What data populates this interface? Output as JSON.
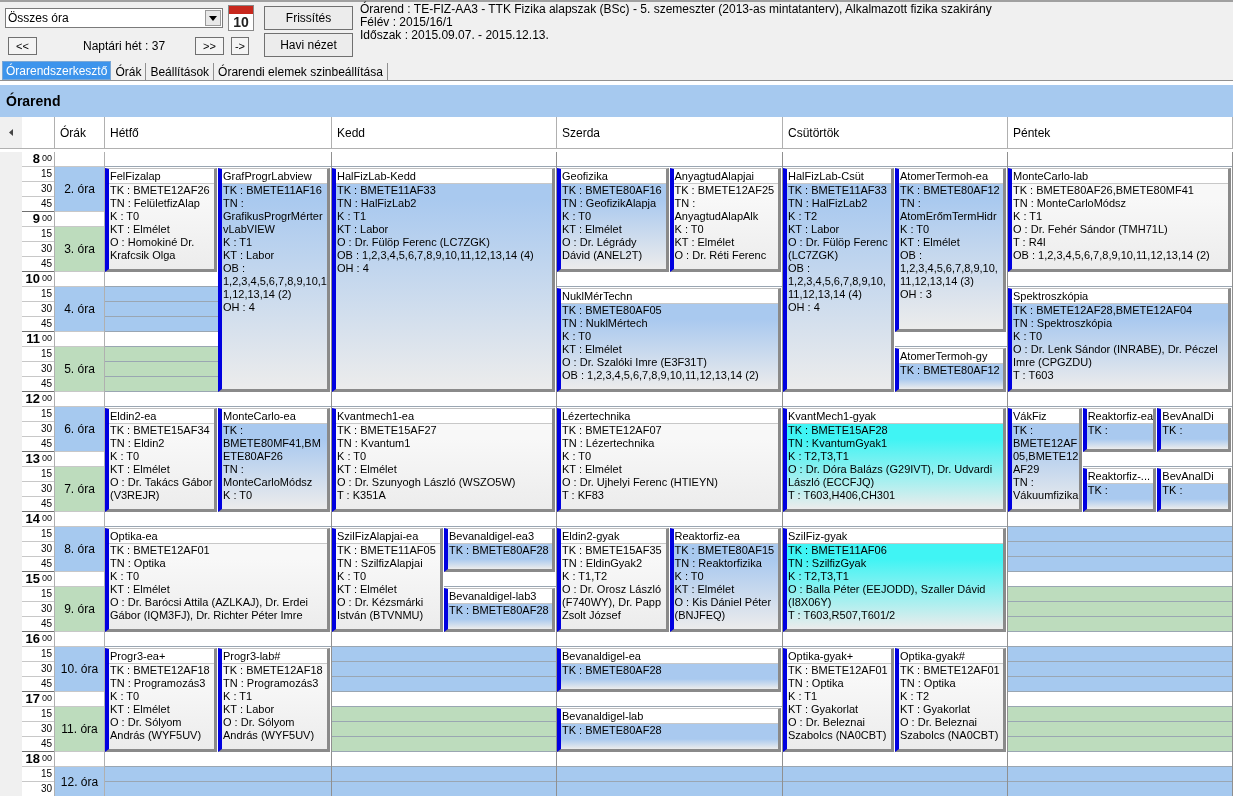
{
  "toolbar": {
    "filter": {
      "value": "Összes óra"
    },
    "calendar_day": "10",
    "prev_button": "<<",
    "week_label": "Naptári hét : 37",
    "next_button": ">>",
    "goto_button": "->",
    "refresh_button": "Frissítés",
    "month_button": "Havi nézet"
  },
  "info": [
    "Órarend : TE-FIZ-AA3 - TTK Fizika alapszak (BSc) - 5. szemeszter (2013-as mintatanterv), Alkalmazott fizika szakirány",
    "Félév : 2015/16/1",
    "Időszak : 2015.09.07. - 2015.12.13."
  ],
  "tabs": [
    {
      "label": "Órarendszerkesztő",
      "selected": true
    },
    {
      "label": "Órák",
      "selected": false
    },
    {
      "label": "Beállítások",
      "selected": false
    },
    {
      "label": "Órarendi elemek szinbeállítása",
      "selected": false
    }
  ],
  "panel_title": "Órarend",
  "periods_header": "Órák",
  "hours": [
    {
      "hour": "8",
      "minutes": [
        "00",
        "15",
        "30",
        "45"
      ]
    },
    {
      "hour": "9",
      "minutes": [
        "00",
        "15",
        "30",
        "45"
      ]
    },
    {
      "hour": "10",
      "minutes": [
        "00",
        "15",
        "30",
        "45"
      ]
    },
    {
      "hour": "11",
      "minutes": [
        "00",
        "15",
        "30",
        "45"
      ]
    },
    {
      "hour": "12",
      "minutes": [
        "00",
        "15",
        "30",
        "45"
      ]
    },
    {
      "hour": "13",
      "minutes": [
        "00",
        "15",
        "30",
        "45"
      ]
    },
    {
      "hour": "14",
      "minutes": [
        "00",
        "15",
        "30",
        "45"
      ]
    },
    {
      "hour": "15",
      "minutes": [
        "00",
        "15",
        "30",
        "45"
      ]
    },
    {
      "hour": "16",
      "minutes": [
        "00",
        "15",
        "30",
        "45"
      ]
    },
    {
      "hour": "17",
      "minutes": [
        "00",
        "15",
        "30",
        "45"
      ]
    },
    {
      "hour": "18",
      "minutes": [
        "00",
        "15",
        "30"
      ]
    }
  ],
  "periods": [
    "2. óra",
    "3. óra",
    "4. óra",
    "5. óra",
    "6. óra",
    "7. óra",
    "8. óra",
    "9. óra",
    "10. óra",
    "11. óra",
    "12. óra"
  ],
  "days": [
    {
      "name": "Hétfő",
      "blocks": [
        {
          "lanes": [
            [
              {
                "title": "FelFizalap",
                "kind": "double",
                "color": "#f8f8f8",
                "lines": [
                  "TK : BMETE12AF26",
                  "TN : FelületfizAlap",
                  "K : T0",
                  "KT : Elmélet",
                  "O :  Homokiné Dr. Krafcsik Olga"
                ]
              }
            ],
            [
              {
                "title": "GrafProgrLabview",
                "kind": "quad",
                "color": "#a9c9ef",
                "lines": [
                  "TK : BMETE11AF16",
                  "TN : GrafikusProgrMértervLabVIEW",
                  "K : T1",
                  "KT : Labor",
                  "OB : 1,2,3,4,5,6,7,8,9,10,11,12,13,14 (2)",
                  "OH : 4"
                ]
              }
            ]
          ]
        },
        {
          "lanes": [
            [
              {
                "title": "Eldin2-ea",
                "kind": "double",
                "color": "#f8f8f8",
                "lines": [
                  "TK : BMETE15AF34",
                  "TN : Eldin2",
                  "K : T0",
                  "KT : Elmélet",
                  "O :  Dr. Takács Gábor (V3REJR)"
                ]
              }
            ],
            [
              {
                "title": "MonteCarlo-ea",
                "kind": "double",
                "color": "#a9c9ef",
                "lines": [
                  "TK : BMETE80MF41,BMETE80AF26",
                  "TN : MonteCarloMódsz",
                  "K : T0"
                ]
              }
            ]
          ]
        },
        {
          "lanes": [
            [
              {
                "title": "Optika-ea",
                "kind": "double",
                "color": "#f8f8f8",
                "lines": [
                  "TK : BMETE12AF01",
                  "TN : Optika",
                  "K : T0",
                  "KT : Elmélet",
                  "O :  Dr. Barócsi Attila (AZLKAJ), Dr. Erdei Gábor (IQM3FJ), Dr. Richter Péter Imre"
                ]
              }
            ]
          ]
        },
        {
          "lanes": [
            [
              {
                "title": "Progr3-ea+",
                "kind": "double",
                "color": "#f8f8f8",
                "lines": [
                  "TK : BMETE12AF18",
                  "TN : Programozás3",
                  "K : T0",
                  "KT : Elmélet",
                  "O :  Dr. Sólyom András (WYF5UV)"
                ]
              }
            ],
            [
              {
                "title": "Progr3-lab#",
                "kind": "double",
                "color": "#f8f8f8",
                "lines": [
                  "TK : BMETE12AF18",
                  "TN : Programozás3",
                  "K : T1",
                  "KT : Labor",
                  "O :  Dr. Sólyom András (WYF5UV)"
                ]
              }
            ]
          ]
        }
      ]
    },
    {
      "name": "Kedd",
      "blocks": [
        {
          "lanes": [
            [
              {
                "title": "HalFizLab-Kedd",
                "kind": "quad",
                "color": "#a9c9ef",
                "lines": [
                  "TK : BMETE11AF33",
                  "TN : HalFizLab2",
                  "K : T1",
                  "KT : Labor",
                  "O :  Dr. Fülöp Ferenc (LC7ZGK)",
                  "OB : 1,2,3,4,5,6,7,8,9,10,11,12,13,14 (4)",
                  "OH : 4"
                ]
              }
            ]
          ]
        },
        {
          "lanes": [
            [
              {
                "title": "Kvantmech1-ea",
                "kind": "double",
                "color": "#f8f8f8",
                "lines": [
                  "TK : BMETE15AF27",
                  "TN : Kvantum1",
                  "K : T0",
                  "KT : Elmélet",
                  "O :  Dr. Szunyogh László (WSZO5W)",
                  "T : K351A"
                ]
              }
            ]
          ]
        },
        {
          "lanes": [
            [
              {
                "title": "SzilFizAlapjai-ea",
                "kind": "double",
                "color": "#f8f8f8",
                "lines": [
                  "TK : BMETE11AF05",
                  "TN : SzilfizAlapjai",
                  "K : T0",
                  "KT : Elmélet",
                  "O :  Dr. Kézsmárki István (BTVNMU)"
                ]
              }
            ],
            [
              {
                "title": "Bevanaldigel-ea3",
                "kind": "single",
                "color": "#a9c9ef",
                "lines": [
                  "TK : BMETE80AF28"
                ]
              },
              {
                "title": "Bevanaldigel-lab3",
                "kind": "single",
                "color": "#a9c9ef",
                "lines": [
                  "TK : BMETE80AF28"
                ]
              }
            ]
          ]
        }
      ]
    },
    {
      "name": "Szerda",
      "blocks": [
        {
          "lanes": [
            [
              {
                "title": "Geofizika",
                "kind": "double",
                "color": "#a9c9ef",
                "lines": [
                  "TK : BMETE80AF16",
                  "TN : GeofizikAlapja",
                  "K : T0",
                  "KT : Elmélet",
                  "O :  Dr. Légrády Dávid (ANEL2T)"
                ]
              }
            ],
            [
              {
                "title": "AnyagtudAlapjai",
                "kind": "double",
                "color": "#f8f8f8",
                "lines": [
                  "TK : BMETE12AF25",
                  "TN : AnyagtudAlapAlk",
                  "K : T0",
                  "KT : Elmélet",
                  "O :  Dr. Réti Ferenc"
                ]
              }
            ]
          ]
        },
        {
          "lanes": [
            [
              {
                "title": "NuklMérTechn",
                "kind": "double",
                "color": "#a9c9ef",
                "lines": [
                  "TK : BMETE80AF05",
                  "TN : NuklMértech",
                  "K : T0",
                  "KT : Elmélet",
                  "O :  Dr. Szalóki Imre (E3F31T)",
                  "OB : 1,2,3,4,5,6,7,8,9,10,11,12,13,14 (2)"
                ]
              }
            ]
          ]
        },
        {
          "lanes": [
            [
              {
                "title": "Lézertechnika",
                "kind": "double",
                "color": "#f8f8f8",
                "lines": [
                  "TK : BMETE12AF07",
                  "TN : Lézertechnika",
                  "K : T0",
                  "KT : Elmélet",
                  "O :  Dr. Ujhelyi Ferenc (HTIEYN)",
                  "T : KF83"
                ]
              }
            ]
          ]
        },
        {
          "lanes": [
            [
              {
                "title": "Eldin2-gyak",
                "kind": "double",
                "color": "#f8f8f8",
                "lines": [
                  "TK : BMETE15AF35",
                  "TN : EldinGyak2",
                  "K : T1,T2",
                  "O :  Dr. Orosz László (F740WY), Dr. Papp Zsolt József"
                ]
              }
            ],
            [
              {
                "title": "Reaktorfiz-ea",
                "kind": "double",
                "color": "#a9c9ef",
                "lines": [
                  "TK : BMETE80AF15",
                  "TN : Reaktorfizika",
                  "K : T0",
                  "KT : Elmélet",
                  "O :  Kis Dániel Péter (BNJFEQ)"
                ]
              }
            ]
          ]
        },
        {
          "lanes": [
            [
              {
                "title": "Bevanaldigel-ea",
                "kind": "single",
                "color": "#a9c9ef",
                "lines": [
                  "TK : BMETE80AF28"
                ]
              }
            ]
          ]
        },
        {
          "lanes": [
            [
              {
                "title": "Bevanaldigel-lab",
                "kind": "single",
                "color": "#a9c9ef",
                "lines": [
                  "TK : BMETE80AF28"
                ]
              }
            ]
          ]
        }
      ]
    },
    {
      "name": "Csütörtök",
      "blocks": [
        {
          "lanes": [
            [
              {
                "title": "HalFizLab-Csüt",
                "kind": "quad",
                "color": "#a9c9ef",
                "lines": [
                  "TK : BMETE11AF33",
                  "TN : HalFizLab2",
                  "K : T2",
                  "KT : Labor",
                  "O :  Dr. Fülöp Ferenc (LC7ZGK)",
                  "OB : 1,2,3,4,5,6,7,8,9,10,11,12,13,14 (4)",
                  "OH : 4"
                ]
              }
            ],
            [
              {
                "title": "AtomerTermoh-ea",
                "kind": "triple",
                "color": "#a9c9ef",
                "lines": [
                  "TK : BMETE80AF12",
                  "TN : AtomErőmTermHidr",
                  "K : T0",
                  "KT : Elmélet",
                  "OB : 1,2,3,4,5,6,7,8,9,10,11,12,13,14 (3)",
                  "OH : 3"
                ]
              },
              {
                "title": "AtomerTermoh-gy",
                "kind": "single",
                "color": "#a9c9ef",
                "lines": [
                  "TK : BMETE80AF12"
                ]
              }
            ]
          ]
        },
        {
          "lanes": [
            [
              {
                "title": "KvantMech1-gyak",
                "kind": "double",
                "color": "#40f4f4",
                "lines": [
                  "TK : BMETE15AF28",
                  "TN : KvantumGyak1",
                  "K : T2,T3,T1",
                  "O :  Dr. Dóra Balázs (G29IVT), Dr. Udvardi László (ECCFJQ)",
                  "T : T603,H406,CH301"
                ]
              }
            ]
          ]
        },
        {
          "lanes": [
            [
              {
                "title": "SzilFiz-gyak",
                "kind": "double",
                "color": "#40f4f4",
                "lines": [
                  "TK : BMETE11AF06",
                  "TN : SzilfizGyak",
                  "K : T2,T3,T1",
                  "O :  Balla Péter (EEJODD), Szaller Dávid (I8X06Y)",
                  "T : T603,R507,T601/2"
                ]
              }
            ]
          ]
        },
        {
          "lanes": [
            [
              {
                "title": "Optika-gyak+",
                "kind": "double",
                "color": "#f8f8f8",
                "lines": [
                  "TK : BMETE12AF01",
                  "TN : Optika",
                  "K : T1",
                  "KT : Gyakorlat",
                  "O :  Dr. Beleznai Szabolcs (NA0CBT)"
                ]
              }
            ],
            [
              {
                "title": "Optika-gyak#",
                "kind": "double",
                "color": "#f8f8f8",
                "lines": [
                  "TK : BMETE12AF01",
                  "TN : Optika",
                  "K : T2",
                  "KT : Gyakorlat",
                  "O :  Dr. Beleznai Szabolcs (NA0CBT)"
                ]
              }
            ]
          ]
        }
      ]
    },
    {
      "name": "Péntek",
      "blocks": [
        {
          "lanes": [
            [
              {
                "title": "MonteCarlo-lab",
                "kind": "double",
                "color": "#f8f8f8",
                "lines": [
                  "TK : BMETE80AF26,BMETE80MF41",
                  "TN : MonteCarloMódsz",
                  "K : T1",
                  "O :  Dr. Fehér Sándor (TMH71L)",
                  "T : R4I",
                  "OB : 1,2,3,4,5,6,7,8,9,10,11,12,13,14 (2)"
                ]
              }
            ]
          ]
        },
        {
          "lanes": [
            [
              {
                "title": "Spektroszkópia",
                "kind": "double",
                "color": "#a9c9ef",
                "lines": [
                  "TK : BMETE12AF28,BMETE12AF04",
                  "TN : Spektroszkópia",
                  "K : T0",
                  "O :  Dr. Lenk Sándor (INRABE), Dr. Péczel Imre (CPGZDU)",
                  "T : T603"
                ]
              }
            ]
          ]
        },
        {
          "lanes": [
            [
              {
                "title": "VákFiz",
                "kind": "double",
                "color": "#a9c9ef",
                "lines": [
                  "TK : BMETE12AF05,BMETE12AF29",
                  "TN : Vákuumfizika"
                ]
              }
            ],
            [
              {
                "title": "Reaktorfiz-ea",
                "kind": "single",
                "color": "#a9c9ef",
                "lines": [
                  "TK :"
                ]
              },
              {
                "title": "Reaktorfiz-...",
                "kind": "single",
                "color": "#a9c9ef",
                "lines": [
                  "TK :"
                ]
              }
            ],
            [
              {
                "title": "BevAnalDi",
                "kind": "single",
                "color": "#a9c9ef",
                "lines": [
                  "TK :"
                ]
              },
              {
                "title": "BevAnalDi",
                "kind": "single",
                "color": "#a9c9ef",
                "lines": [
                  "TK :"
                ]
              }
            ]
          ]
        }
      ]
    }
  ]
}
